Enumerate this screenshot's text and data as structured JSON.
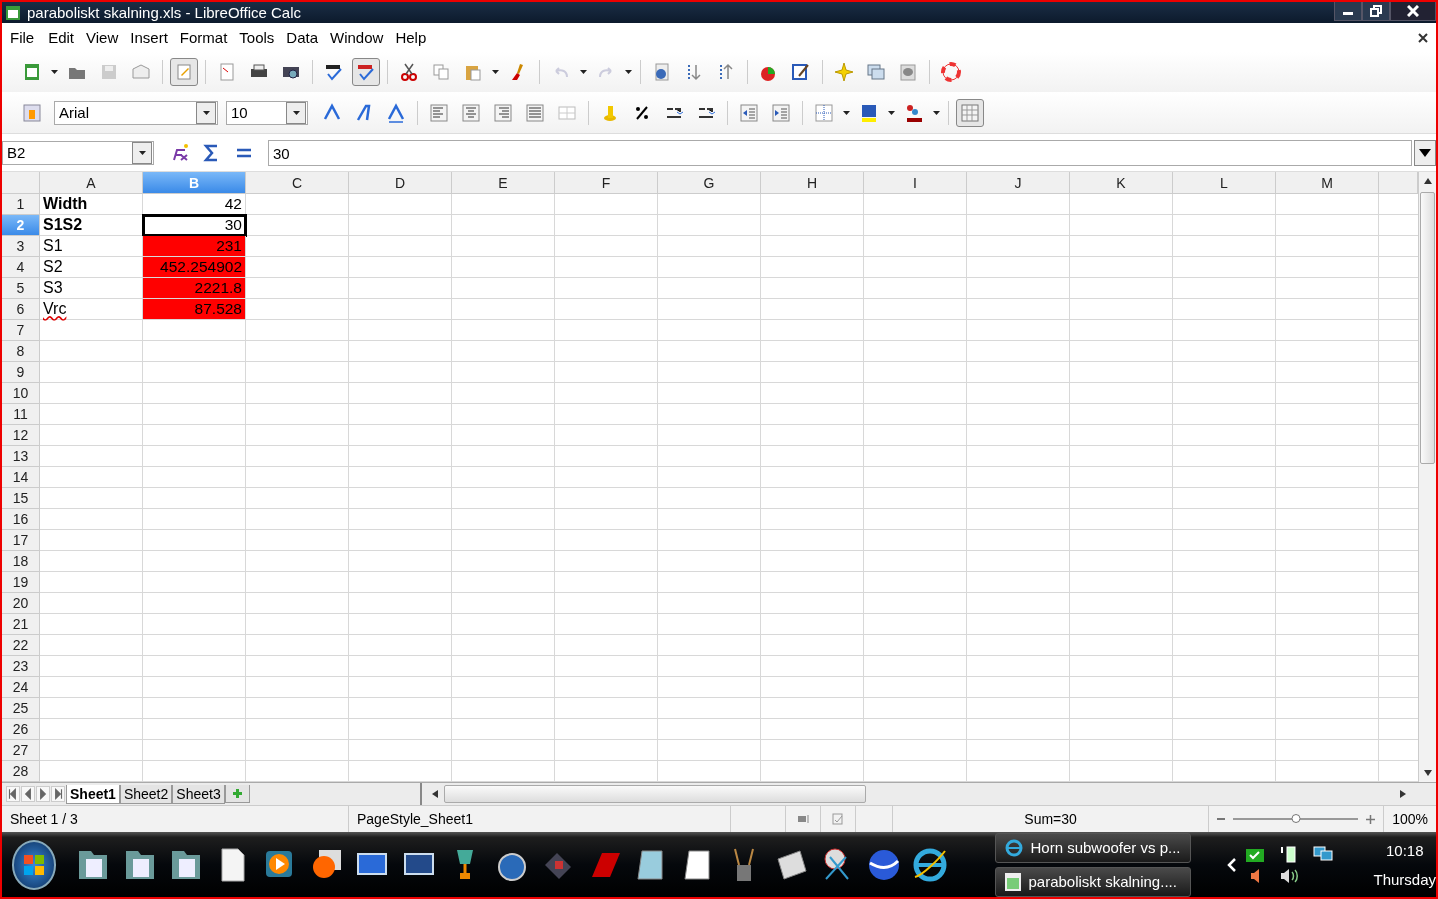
{
  "window": {
    "title": "paraboliskt skalning.xls - LibreOffice Calc"
  },
  "menu": [
    "File",
    "Edit",
    "View",
    "Insert",
    "Format",
    "Tools",
    "Data",
    "Window",
    "Help"
  ],
  "standard_toolbar": {
    "edit_file_on": true,
    "auto_spellcheck_on": true,
    "save_enabled": false,
    "undo_enabled": false,
    "redo_enabled": false
  },
  "formatting_toolbar": {
    "font_name": "Arial",
    "font_size": "10",
    "grid_lines_on": true
  },
  "formula_bar": {
    "name_box": "B2",
    "value": "30"
  },
  "columns": [
    {
      "label": "A",
      "selected": false
    },
    {
      "label": "B",
      "selected": true
    },
    {
      "label": "C",
      "selected": false
    },
    {
      "label": "D",
      "selected": false
    },
    {
      "label": "E",
      "selected": false
    },
    {
      "label": "F",
      "selected": false
    },
    {
      "label": "G",
      "selected": false
    },
    {
      "label": "H",
      "selected": false
    },
    {
      "label": "I",
      "selected": false
    },
    {
      "label": "J",
      "selected": false
    },
    {
      "label": "K",
      "selected": false
    },
    {
      "label": "L",
      "selected": false
    },
    {
      "label": "M",
      "selected": false
    }
  ],
  "rows": [
    {
      "label": "1",
      "selected": false,
      "cells": [
        {
          "text": "Width",
          "kind": "text",
          "bold": true,
          "highlighted": false,
          "misspelled": false,
          "selected": false
        },
        {
          "text": "42",
          "kind": "number",
          "bold": false,
          "highlighted": false,
          "misspelled": false,
          "selected": false
        }
      ]
    },
    {
      "label": "2",
      "selected": true,
      "cells": [
        {
          "text": "S1S2",
          "kind": "text",
          "bold": true,
          "highlighted": false,
          "misspelled": false,
          "selected": false
        },
        {
          "text": "30",
          "kind": "number",
          "bold": false,
          "highlighted": false,
          "misspelled": false,
          "selected": true
        }
      ]
    },
    {
      "label": "3",
      "selected": false,
      "cells": [
        {
          "text": "S1",
          "kind": "text",
          "bold": false,
          "highlighted": false,
          "misspelled": false,
          "selected": false
        },
        {
          "text": "231",
          "kind": "number",
          "bold": false,
          "highlighted": true,
          "misspelled": false,
          "selected": false
        }
      ]
    },
    {
      "label": "4",
      "selected": false,
      "cells": [
        {
          "text": "S2",
          "kind": "text",
          "bold": false,
          "highlighted": false,
          "misspelled": false,
          "selected": false
        },
        {
          "text": "452.254902",
          "kind": "number",
          "bold": false,
          "highlighted": true,
          "misspelled": false,
          "selected": false
        }
      ]
    },
    {
      "label": "5",
      "selected": false,
      "cells": [
        {
          "text": "S3",
          "kind": "text",
          "bold": false,
          "highlighted": false,
          "misspelled": false,
          "selected": false
        },
        {
          "text": "2221.8",
          "kind": "number",
          "bold": false,
          "highlighted": true,
          "misspelled": false,
          "selected": false
        }
      ]
    },
    {
      "label": "6",
      "selected": false,
      "cells": [
        {
          "text": "Vrc",
          "kind": "text",
          "bold": false,
          "highlighted": false,
          "misspelled": true,
          "selected": false
        },
        {
          "text": "87.528",
          "kind": "number",
          "bold": false,
          "highlighted": true,
          "misspelled": false,
          "selected": false
        }
      ]
    },
    {
      "label": "7",
      "selected": false
    },
    {
      "label": "8",
      "selected": false
    },
    {
      "label": "9",
      "selected": false
    },
    {
      "label": "10",
      "selected": false
    },
    {
      "label": "11",
      "selected": false
    },
    {
      "label": "12",
      "selected": false
    },
    {
      "label": "13",
      "selected": false
    },
    {
      "label": "14",
      "selected": false
    },
    {
      "label": "15",
      "selected": false
    },
    {
      "label": "16",
      "selected": false
    },
    {
      "label": "17",
      "selected": false
    },
    {
      "label": "18",
      "selected": false
    },
    {
      "label": "19",
      "selected": false
    },
    {
      "label": "20",
      "selected": false
    },
    {
      "label": "21",
      "selected": false
    },
    {
      "label": "22",
      "selected": false
    },
    {
      "label": "23",
      "selected": false
    },
    {
      "label": "24",
      "selected": false
    },
    {
      "label": "25",
      "selected": false
    },
    {
      "label": "26",
      "selected": false
    },
    {
      "label": "27",
      "selected": false
    },
    {
      "label": "28",
      "selected": false
    }
  ],
  "sheet_tabs": [
    {
      "label": "Sheet1",
      "selected": true
    },
    {
      "label": "Sheet2",
      "selected": false
    },
    {
      "label": "Sheet3",
      "selected": false
    }
  ],
  "status_bar": {
    "sheet": "Sheet 1 / 3",
    "page_style": "PageStyle_Sheet1",
    "sum": "Sum=30",
    "zoom_slider": {
      "level": 0.5
    },
    "zoom": "100%"
  },
  "taskbar": {
    "tasks": [
      {
        "label": "Horn subwoofer vs p...",
        "kind": "browser"
      },
      {
        "label": "paraboliskt skalning....",
        "kind": "spreadsheet"
      }
    ],
    "time": "10:18",
    "day": "Thursday"
  }
}
